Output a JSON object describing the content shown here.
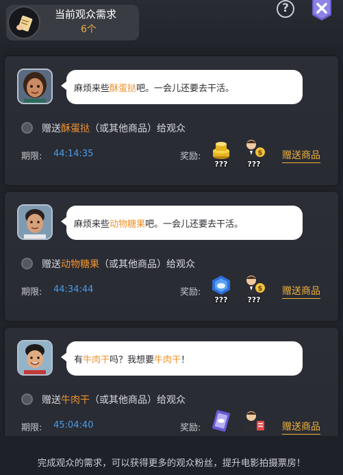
{
  "header": {
    "title": "当前观众需求",
    "count": "6个"
  },
  "cards": [
    {
      "bubble": {
        "pre": "麻烦来些",
        "item": "酥蛋挞",
        "post": "吧。一会儿还要去干活。"
      },
      "gift": {
        "pre": "赠送",
        "item": "酥蛋挞",
        "post": "（或其他商品）给观众"
      },
      "deadline_label": "期限:",
      "deadline": "44:14:35",
      "reward_label": "奖励:",
      "rewards": [
        {
          "icon": "gold-coins-icon",
          "label": "???"
        },
        {
          "icon": "fan-person-icon",
          "label": "???"
        }
      ],
      "action": "赠送商品"
    },
    {
      "bubble": {
        "pre": "麻烦来些",
        "item": "动物糖果",
        "post": "吧。一会儿还要去干活。"
      },
      "gift": {
        "pre": "赠送",
        "item": "动物糖果",
        "post": "（或其他商品）给观众"
      },
      "deadline_label": "期限:",
      "deadline": "44:34:44",
      "reward_label": "奖励:",
      "rewards": [
        {
          "icon": "blue-gem-icon",
          "label": "???"
        },
        {
          "icon": "fan-person-icon",
          "label": "???"
        }
      ],
      "action": "赠送商品"
    },
    {
      "bubble": {
        "pre": "有",
        "item": "牛肉干",
        "mid": "吗？我想要",
        "item2": "牛肉干",
        "post": "！"
      },
      "gift": {
        "pre": "赠送",
        "item": "牛肉干",
        "post": "（或其他商品）给观众"
      },
      "deadline_label": "期限:",
      "deadline": "45:04:40",
      "reward_label": "奖励:",
      "rewards": [
        {
          "icon": "script-card-icon",
          "label": ""
        },
        {
          "icon": "staff-person-icon",
          "label": ""
        }
      ],
      "action": "赠送商品"
    }
  ],
  "footer": {
    "text": "完成观众的需求，可以获得更多的观众粉丝，提升电影拍摄票房！"
  },
  "colors": {
    "highlight": "#f0922a",
    "deadline": "#4a9ce8",
    "action": "#f0b23a"
  }
}
